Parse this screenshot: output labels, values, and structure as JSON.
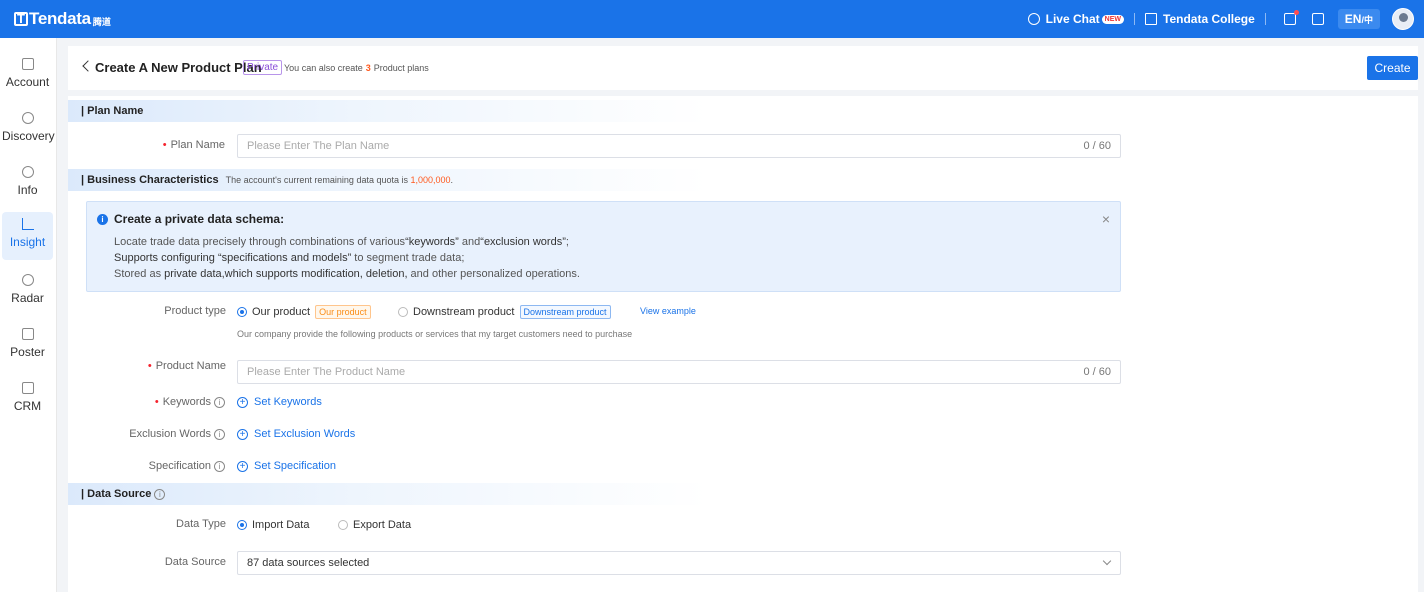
{
  "brand": {
    "logo_text": "Tendata",
    "logo_suffix": "腾道"
  },
  "topbar": {
    "live_chat": "Live Chat",
    "new_badge": "NEW",
    "college": "Tendata College",
    "lang": "EN",
    "lang_alt": "中"
  },
  "sidebar": {
    "items": [
      {
        "label": "Account",
        "icon": "home-icon"
      },
      {
        "label": "Discovery",
        "icon": "discovery-icon"
      },
      {
        "label": "Info",
        "icon": "info-search-icon"
      },
      {
        "label": "Insight",
        "icon": "insight-chart-icon",
        "active": true
      },
      {
        "label": "Radar",
        "icon": "radar-icon"
      },
      {
        "label": "Poster",
        "icon": "poster-icon"
      },
      {
        "label": "CRM",
        "icon": "crm-icon"
      }
    ]
  },
  "header": {
    "title": "Create A New Product Plan",
    "private_tag": "Private",
    "note_prefix": "You can also create",
    "note_count": "3",
    "note_suffix": "Product plans",
    "create_button": "Create"
  },
  "plan_section": {
    "heading": "| Plan Name",
    "plan_name_label": "Plan Name",
    "plan_name_placeholder": "Please Enter The Plan Name",
    "plan_name_count": "0 / 60"
  },
  "business_section": {
    "heading": "| Business Characteristics",
    "quota_prefix": "The account's current remaining data quota is",
    "quota_value": "1,000,000",
    "quota_suffix": ".",
    "alert": {
      "title": "Create a private data schema:",
      "line1_a": "Locate trade data precisely through combinations of various",
      "line1_b": "“keywords”",
      "line1_c": " and",
      "line1_d": "“exclusion words”",
      "line1_e": ";",
      "line2_a": "Supports configuring “specifications and models”",
      "line2_b": " to segment trade data;",
      "line3_a": "Stored as ",
      "line3_b": "private data,which supports modification, deletion,",
      "line3_c": "  and other personalized operations."
    },
    "product_type_label": "Product type",
    "our_product": "Our product",
    "our_product_tag": "Our product",
    "downstream_product": "Downstream product",
    "downstream_tag": "Downstream product",
    "view_example": "View example",
    "product_type_hint": "Our company provide the following products or services that my target customers need to purchase",
    "product_name_label": "Product Name",
    "product_name_placeholder": "Please Enter The Product Name",
    "product_name_count": "0 / 60",
    "keywords_label": "Keywords",
    "set_keywords": "Set Keywords",
    "exclusion_label": "Exclusion Words",
    "set_exclusion": "Set Exclusion Words",
    "specification_label": "Specification",
    "set_specification": "Set Specification"
  },
  "data_source_section": {
    "heading": "| Data Source",
    "data_type_label": "Data Type",
    "import_data": "Import Data",
    "export_data": "Export Data",
    "data_source_label": "Data Source",
    "data_source_value": "87 data sources selected"
  }
}
